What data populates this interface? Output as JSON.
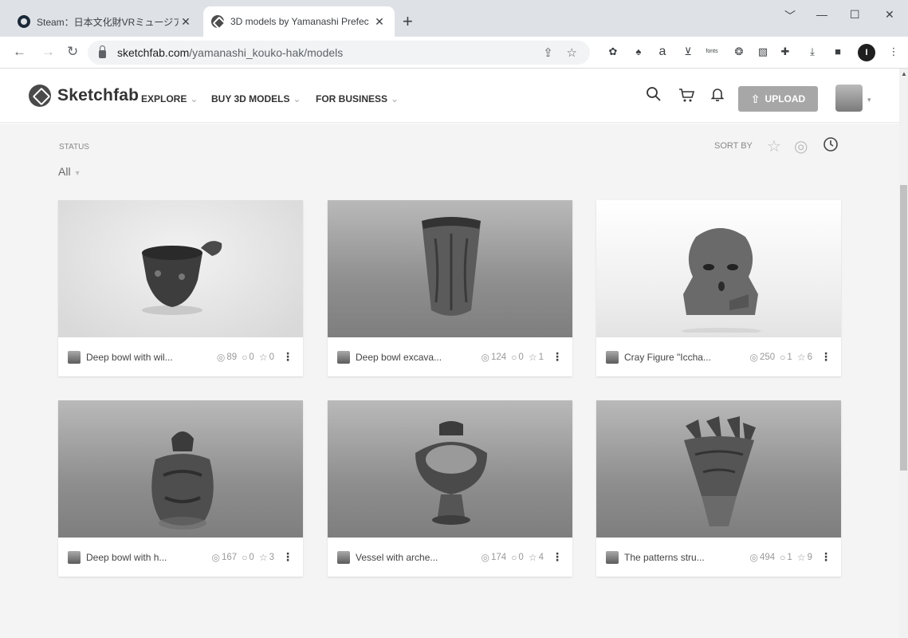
{
  "browser": {
    "tabs": [
      {
        "title": "Steam：日本文化財VRミュージアム",
        "active": false
      },
      {
        "title": "3D models by Yamanashi Prefec",
        "active": true
      }
    ],
    "new_tab": "+",
    "url_host": "sketchfab.com",
    "url_path": "/yamanashi_kouko-hak/models",
    "profile_initial": "I",
    "fonts_ext_label": "fonts"
  },
  "header": {
    "logo": "Sketchfab",
    "nav": [
      "EXPLORE",
      "BUY 3D MODELS",
      "FOR BUSINESS"
    ],
    "upload_label": "UPLOAD"
  },
  "filters": {
    "status_label": "STATUS",
    "status_value": "All",
    "sort_label": "SORT BY"
  },
  "models": [
    {
      "title": "Deep bowl with wil...",
      "views": "89",
      "comments": "0",
      "likes": "0"
    },
    {
      "title": "Deep bowl excava...",
      "views": "124",
      "comments": "0",
      "likes": "1"
    },
    {
      "title": "Cray Figure \"Iccha...",
      "views": "250",
      "comments": "1",
      "likes": "6"
    },
    {
      "title": "Deep bowl with h...",
      "views": "167",
      "comments": "0",
      "likes": "3"
    },
    {
      "title": "Vessel with arche...",
      "views": "174",
      "comments": "0",
      "likes": "4"
    },
    {
      "title": "The patterns stru...",
      "views": "494",
      "comments": "1",
      "likes": "9"
    }
  ],
  "colors": {
    "upload_button": "#a7a7a7",
    "content_bg": "#f4f4f4"
  }
}
